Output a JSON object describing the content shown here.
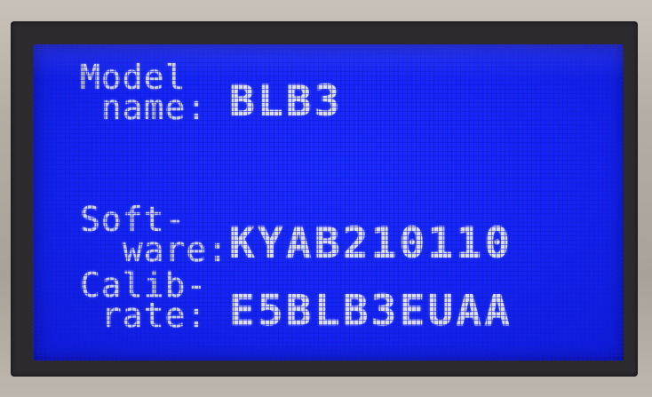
{
  "display": {
    "rows": [
      {
        "label_line1": "Model",
        "label_line2": " name:",
        "value": "BLB3"
      },
      {
        "label_line1": "Soft-",
        "label_line2": "  ware:",
        "value": "KYAB210110"
      },
      {
        "label_line1": "Calib-",
        "label_line2": " rate:",
        "value": "E5BLB3EUAA"
      }
    ]
  },
  "colors": {
    "screen_bg": "#1424f2",
    "text": "#d9dcf2",
    "bezel": "#2c2a2e"
  }
}
